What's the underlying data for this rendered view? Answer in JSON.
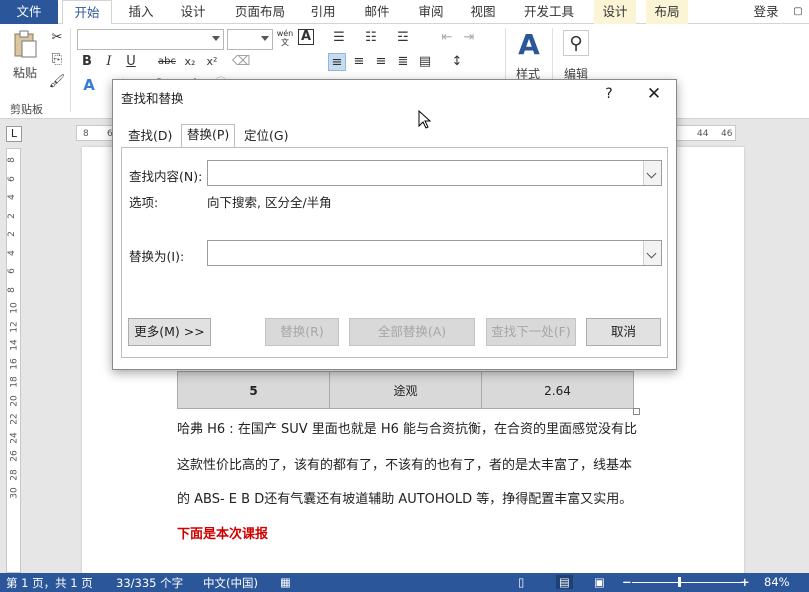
{
  "tabs": {
    "file": "文件",
    "home": "开始",
    "insert": "插入",
    "design": "设计",
    "layout": "页面布局",
    "references": "引用",
    "mailings": "邮件",
    "review": "审阅",
    "view": "视图",
    "developer": "开发工具",
    "table_design": "设计",
    "table_layout": "布局",
    "signin": "登录"
  },
  "ribbon": {
    "paste": "粘贴",
    "clipboard": "剪贴板",
    "styles": "样式",
    "edit": "编辑",
    "bold": "B",
    "italic": "I",
    "underline": "U",
    "strike": "abc",
    "subscript": "x₂",
    "superscript": "x²",
    "wen": "wén\n文"
  },
  "ruler": {
    "h": [
      "8",
      "6",
      "44",
      "46"
    ],
    "v": [
      "8",
      "6",
      "4",
      "2",
      "2",
      "4",
      "6",
      "8",
      "10",
      "12",
      "14",
      "16",
      "18",
      "20",
      "22",
      "24",
      "26",
      "28",
      "30"
    ]
  },
  "doc": {
    "table_row": [
      "5",
      "途观",
      "2.64"
    ],
    "p1": "哈弗 H6 : 在国产 SUV 里面也就是 H6 能与合资抗衡，在合资的里面感觉没有比",
    "p2": "这款性价比高的了，该有的都有了，不该有的也有了，者的是太丰富了，线基本",
    "p3": "的 ABS- E B D还有气囊还有坡道辅助 AUTOHOLD 等，挣得配置丰富又实用。",
    "p4": "下面是本次课报"
  },
  "dialog": {
    "title": "查找和替换",
    "help": "?",
    "close": "✕",
    "tab_find": "查找(D)",
    "tab_replace": "替换(P)",
    "tab_goto": "定位(G)",
    "find_label": "查找内容(N):",
    "find_value": "",
    "options_label": "选项:",
    "options_value": "向下搜索, 区分全/半角",
    "replace_label": "替换为(I):",
    "replace_value": "",
    "more": "更多(M) >>",
    "replace_btn": "替换(R)",
    "replace_all": "全部替换(A)",
    "find_next": "查找下一处(F)",
    "cancel": "取消"
  },
  "status": {
    "page": "第 1 页，共 1 页",
    "words": "33/335 个字",
    "lang": "中文(中国)",
    "zoom_minus": "−",
    "zoom_plus": "+",
    "zoom": "84%"
  }
}
